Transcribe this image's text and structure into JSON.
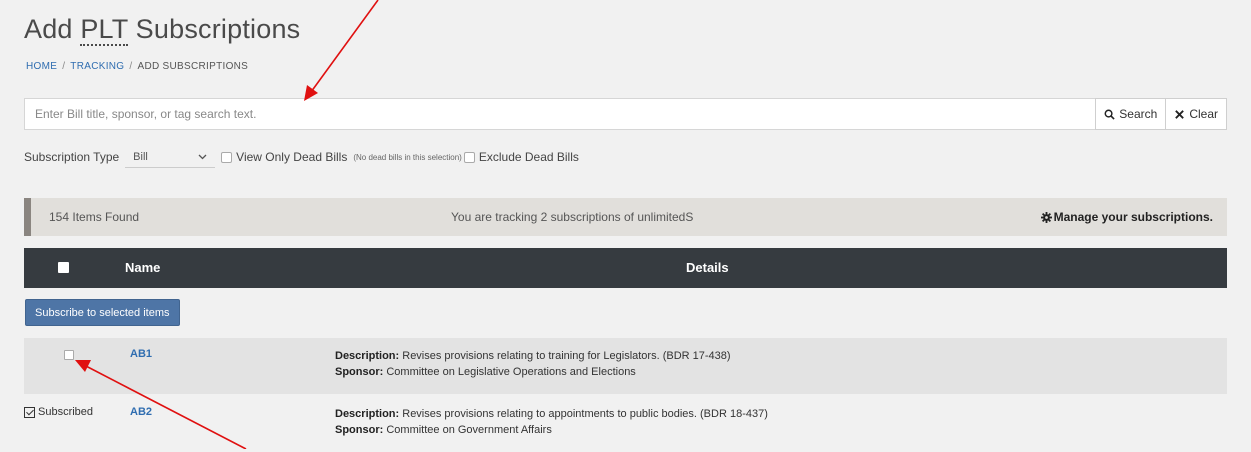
{
  "header": {
    "title_prefix": "Add ",
    "title_abbr": "PLT",
    "title_suffix": " Subscriptions"
  },
  "breadcrumb": {
    "items": [
      "HOME",
      "TRACKING",
      "ADD SUBSCRIPTIONS"
    ]
  },
  "search": {
    "placeholder": "Enter Bill title, sponsor, or tag search text.",
    "search_label": "Search",
    "clear_label": "Clear"
  },
  "filters": {
    "subscription_type_label": "Subscription Type",
    "subscription_type_value": "Bill",
    "view_dead_label": "View Only Dead Bills",
    "view_dead_note": "(No dead bills in this selection)",
    "exclude_dead_label": "Exclude Dead Bills"
  },
  "info": {
    "items_found": "154 Items Found",
    "tracking_text": "You are tracking 2 subscriptions of unlimitedS",
    "manage_label": "Manage your subscriptions."
  },
  "table": {
    "col_name": "Name",
    "col_details": "Details"
  },
  "subscribe_button": "Subscribe to selected items",
  "rows": [
    {
      "name": "AB1",
      "description_label": "Description:",
      "description": "Revises provisions relating to training for Legislators. (BDR 17-438)",
      "sponsor_label": "Sponsor:",
      "sponsor": "Committee on Legislative Operations and Elections",
      "status": ""
    },
    {
      "name": "AB2",
      "description_label": "Description:",
      "description": "Revises provisions relating to appointments to public bodies. (BDR 18-437)",
      "sponsor_label": "Sponsor:",
      "sponsor": "Committee on Government Affairs",
      "status": "Subscribed"
    }
  ],
  "colors": {
    "annotation_arrow": "#e01010",
    "link": "#2f6db0",
    "header_bg": "#363b40",
    "primary_button": "#4e75a6"
  }
}
